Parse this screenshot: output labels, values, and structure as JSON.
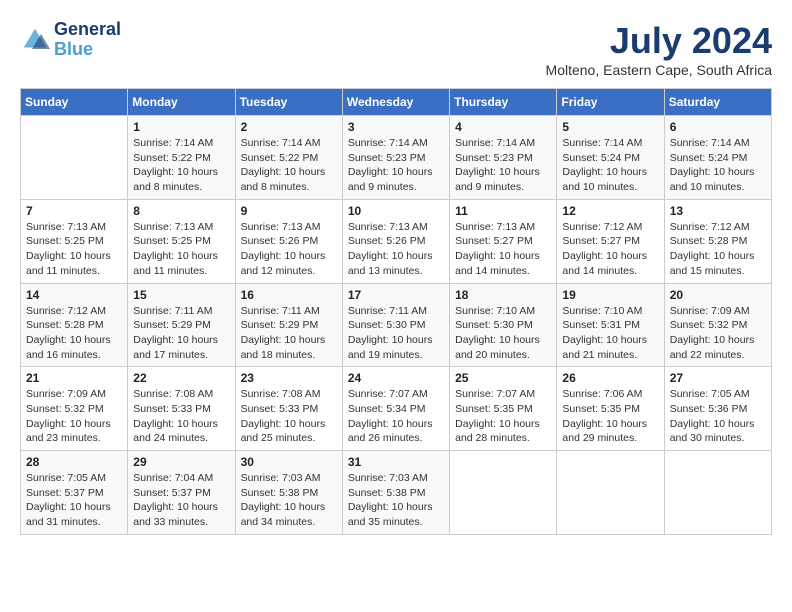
{
  "logo": {
    "line1": "General",
    "line2": "Blue"
  },
  "title": "July 2024",
  "location": "Molteno, Eastern Cape, South Africa",
  "days_header": [
    "Sunday",
    "Monday",
    "Tuesday",
    "Wednesday",
    "Thursday",
    "Friday",
    "Saturday"
  ],
  "weeks": [
    [
      {
        "num": "",
        "sunrise": "",
        "sunset": "",
        "daylight": ""
      },
      {
        "num": "1",
        "sunrise": "Sunrise: 7:14 AM",
        "sunset": "Sunset: 5:22 PM",
        "daylight": "Daylight: 10 hours and 8 minutes."
      },
      {
        "num": "2",
        "sunrise": "Sunrise: 7:14 AM",
        "sunset": "Sunset: 5:22 PM",
        "daylight": "Daylight: 10 hours and 8 minutes."
      },
      {
        "num": "3",
        "sunrise": "Sunrise: 7:14 AM",
        "sunset": "Sunset: 5:23 PM",
        "daylight": "Daylight: 10 hours and 9 minutes."
      },
      {
        "num": "4",
        "sunrise": "Sunrise: 7:14 AM",
        "sunset": "Sunset: 5:23 PM",
        "daylight": "Daylight: 10 hours and 9 minutes."
      },
      {
        "num": "5",
        "sunrise": "Sunrise: 7:14 AM",
        "sunset": "Sunset: 5:24 PM",
        "daylight": "Daylight: 10 hours and 10 minutes."
      },
      {
        "num": "6",
        "sunrise": "Sunrise: 7:14 AM",
        "sunset": "Sunset: 5:24 PM",
        "daylight": "Daylight: 10 hours and 10 minutes."
      }
    ],
    [
      {
        "num": "7",
        "sunrise": "Sunrise: 7:13 AM",
        "sunset": "Sunset: 5:25 PM",
        "daylight": "Daylight: 10 hours and 11 minutes."
      },
      {
        "num": "8",
        "sunrise": "Sunrise: 7:13 AM",
        "sunset": "Sunset: 5:25 PM",
        "daylight": "Daylight: 10 hours and 11 minutes."
      },
      {
        "num": "9",
        "sunrise": "Sunrise: 7:13 AM",
        "sunset": "Sunset: 5:26 PM",
        "daylight": "Daylight: 10 hours and 12 minutes."
      },
      {
        "num": "10",
        "sunrise": "Sunrise: 7:13 AM",
        "sunset": "Sunset: 5:26 PM",
        "daylight": "Daylight: 10 hours and 13 minutes."
      },
      {
        "num": "11",
        "sunrise": "Sunrise: 7:13 AM",
        "sunset": "Sunset: 5:27 PM",
        "daylight": "Daylight: 10 hours and 14 minutes."
      },
      {
        "num": "12",
        "sunrise": "Sunrise: 7:12 AM",
        "sunset": "Sunset: 5:27 PM",
        "daylight": "Daylight: 10 hours and 14 minutes."
      },
      {
        "num": "13",
        "sunrise": "Sunrise: 7:12 AM",
        "sunset": "Sunset: 5:28 PM",
        "daylight": "Daylight: 10 hours and 15 minutes."
      }
    ],
    [
      {
        "num": "14",
        "sunrise": "Sunrise: 7:12 AM",
        "sunset": "Sunset: 5:28 PM",
        "daylight": "Daylight: 10 hours and 16 minutes."
      },
      {
        "num": "15",
        "sunrise": "Sunrise: 7:11 AM",
        "sunset": "Sunset: 5:29 PM",
        "daylight": "Daylight: 10 hours and 17 minutes."
      },
      {
        "num": "16",
        "sunrise": "Sunrise: 7:11 AM",
        "sunset": "Sunset: 5:29 PM",
        "daylight": "Daylight: 10 hours and 18 minutes."
      },
      {
        "num": "17",
        "sunrise": "Sunrise: 7:11 AM",
        "sunset": "Sunset: 5:30 PM",
        "daylight": "Daylight: 10 hours and 19 minutes."
      },
      {
        "num": "18",
        "sunrise": "Sunrise: 7:10 AM",
        "sunset": "Sunset: 5:30 PM",
        "daylight": "Daylight: 10 hours and 20 minutes."
      },
      {
        "num": "19",
        "sunrise": "Sunrise: 7:10 AM",
        "sunset": "Sunset: 5:31 PM",
        "daylight": "Daylight: 10 hours and 21 minutes."
      },
      {
        "num": "20",
        "sunrise": "Sunrise: 7:09 AM",
        "sunset": "Sunset: 5:32 PM",
        "daylight": "Daylight: 10 hours and 22 minutes."
      }
    ],
    [
      {
        "num": "21",
        "sunrise": "Sunrise: 7:09 AM",
        "sunset": "Sunset: 5:32 PM",
        "daylight": "Daylight: 10 hours and 23 minutes."
      },
      {
        "num": "22",
        "sunrise": "Sunrise: 7:08 AM",
        "sunset": "Sunset: 5:33 PM",
        "daylight": "Daylight: 10 hours and 24 minutes."
      },
      {
        "num": "23",
        "sunrise": "Sunrise: 7:08 AM",
        "sunset": "Sunset: 5:33 PM",
        "daylight": "Daylight: 10 hours and 25 minutes."
      },
      {
        "num": "24",
        "sunrise": "Sunrise: 7:07 AM",
        "sunset": "Sunset: 5:34 PM",
        "daylight": "Daylight: 10 hours and 26 minutes."
      },
      {
        "num": "25",
        "sunrise": "Sunrise: 7:07 AM",
        "sunset": "Sunset: 5:35 PM",
        "daylight": "Daylight: 10 hours and 28 minutes."
      },
      {
        "num": "26",
        "sunrise": "Sunrise: 7:06 AM",
        "sunset": "Sunset: 5:35 PM",
        "daylight": "Daylight: 10 hours and 29 minutes."
      },
      {
        "num": "27",
        "sunrise": "Sunrise: 7:05 AM",
        "sunset": "Sunset: 5:36 PM",
        "daylight": "Daylight: 10 hours and 30 minutes."
      }
    ],
    [
      {
        "num": "28",
        "sunrise": "Sunrise: 7:05 AM",
        "sunset": "Sunset: 5:37 PM",
        "daylight": "Daylight: 10 hours and 31 minutes."
      },
      {
        "num": "29",
        "sunrise": "Sunrise: 7:04 AM",
        "sunset": "Sunset: 5:37 PM",
        "daylight": "Daylight: 10 hours and 33 minutes."
      },
      {
        "num": "30",
        "sunrise": "Sunrise: 7:03 AM",
        "sunset": "Sunset: 5:38 PM",
        "daylight": "Daylight: 10 hours and 34 minutes."
      },
      {
        "num": "31",
        "sunrise": "Sunrise: 7:03 AM",
        "sunset": "Sunset: 5:38 PM",
        "daylight": "Daylight: 10 hours and 35 minutes."
      },
      {
        "num": "",
        "sunrise": "",
        "sunset": "",
        "daylight": ""
      },
      {
        "num": "",
        "sunrise": "",
        "sunset": "",
        "daylight": ""
      },
      {
        "num": "",
        "sunrise": "",
        "sunset": "",
        "daylight": ""
      }
    ]
  ]
}
